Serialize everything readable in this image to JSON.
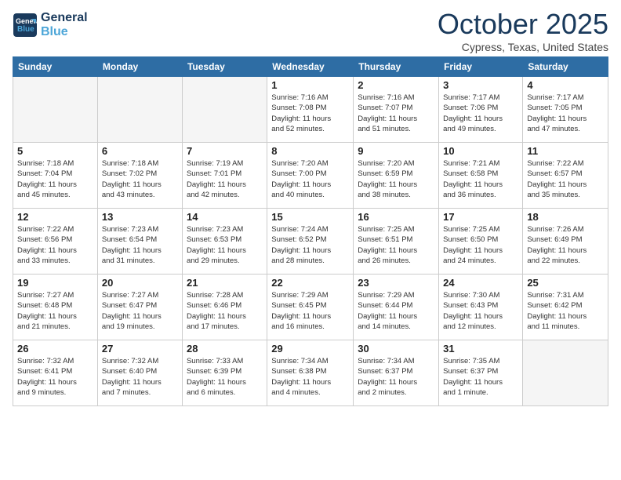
{
  "header": {
    "logo_general": "General",
    "logo_blue": "Blue",
    "month_title": "October 2025",
    "location": "Cypress, Texas, United States"
  },
  "days_of_week": [
    "Sunday",
    "Monday",
    "Tuesday",
    "Wednesday",
    "Thursday",
    "Friday",
    "Saturday"
  ],
  "weeks": [
    [
      {
        "day": "",
        "info": ""
      },
      {
        "day": "",
        "info": ""
      },
      {
        "day": "",
        "info": ""
      },
      {
        "day": "1",
        "info": "Sunrise: 7:16 AM\nSunset: 7:08 PM\nDaylight: 11 hours\nand 52 minutes."
      },
      {
        "day": "2",
        "info": "Sunrise: 7:16 AM\nSunset: 7:07 PM\nDaylight: 11 hours\nand 51 minutes."
      },
      {
        "day": "3",
        "info": "Sunrise: 7:17 AM\nSunset: 7:06 PM\nDaylight: 11 hours\nand 49 minutes."
      },
      {
        "day": "4",
        "info": "Sunrise: 7:17 AM\nSunset: 7:05 PM\nDaylight: 11 hours\nand 47 minutes."
      }
    ],
    [
      {
        "day": "5",
        "info": "Sunrise: 7:18 AM\nSunset: 7:04 PM\nDaylight: 11 hours\nand 45 minutes."
      },
      {
        "day": "6",
        "info": "Sunrise: 7:18 AM\nSunset: 7:02 PM\nDaylight: 11 hours\nand 43 minutes."
      },
      {
        "day": "7",
        "info": "Sunrise: 7:19 AM\nSunset: 7:01 PM\nDaylight: 11 hours\nand 42 minutes."
      },
      {
        "day": "8",
        "info": "Sunrise: 7:20 AM\nSunset: 7:00 PM\nDaylight: 11 hours\nand 40 minutes."
      },
      {
        "day": "9",
        "info": "Sunrise: 7:20 AM\nSunset: 6:59 PM\nDaylight: 11 hours\nand 38 minutes."
      },
      {
        "day": "10",
        "info": "Sunrise: 7:21 AM\nSunset: 6:58 PM\nDaylight: 11 hours\nand 36 minutes."
      },
      {
        "day": "11",
        "info": "Sunrise: 7:22 AM\nSunset: 6:57 PM\nDaylight: 11 hours\nand 35 minutes."
      }
    ],
    [
      {
        "day": "12",
        "info": "Sunrise: 7:22 AM\nSunset: 6:56 PM\nDaylight: 11 hours\nand 33 minutes."
      },
      {
        "day": "13",
        "info": "Sunrise: 7:23 AM\nSunset: 6:54 PM\nDaylight: 11 hours\nand 31 minutes."
      },
      {
        "day": "14",
        "info": "Sunrise: 7:23 AM\nSunset: 6:53 PM\nDaylight: 11 hours\nand 29 minutes."
      },
      {
        "day": "15",
        "info": "Sunrise: 7:24 AM\nSunset: 6:52 PM\nDaylight: 11 hours\nand 28 minutes."
      },
      {
        "day": "16",
        "info": "Sunrise: 7:25 AM\nSunset: 6:51 PM\nDaylight: 11 hours\nand 26 minutes."
      },
      {
        "day": "17",
        "info": "Sunrise: 7:25 AM\nSunset: 6:50 PM\nDaylight: 11 hours\nand 24 minutes."
      },
      {
        "day": "18",
        "info": "Sunrise: 7:26 AM\nSunset: 6:49 PM\nDaylight: 11 hours\nand 22 minutes."
      }
    ],
    [
      {
        "day": "19",
        "info": "Sunrise: 7:27 AM\nSunset: 6:48 PM\nDaylight: 11 hours\nand 21 minutes."
      },
      {
        "day": "20",
        "info": "Sunrise: 7:27 AM\nSunset: 6:47 PM\nDaylight: 11 hours\nand 19 minutes."
      },
      {
        "day": "21",
        "info": "Sunrise: 7:28 AM\nSunset: 6:46 PM\nDaylight: 11 hours\nand 17 minutes."
      },
      {
        "day": "22",
        "info": "Sunrise: 7:29 AM\nSunset: 6:45 PM\nDaylight: 11 hours\nand 16 minutes."
      },
      {
        "day": "23",
        "info": "Sunrise: 7:29 AM\nSunset: 6:44 PM\nDaylight: 11 hours\nand 14 minutes."
      },
      {
        "day": "24",
        "info": "Sunrise: 7:30 AM\nSunset: 6:43 PM\nDaylight: 11 hours\nand 12 minutes."
      },
      {
        "day": "25",
        "info": "Sunrise: 7:31 AM\nSunset: 6:42 PM\nDaylight: 11 hours\nand 11 minutes."
      }
    ],
    [
      {
        "day": "26",
        "info": "Sunrise: 7:32 AM\nSunset: 6:41 PM\nDaylight: 11 hours\nand 9 minutes."
      },
      {
        "day": "27",
        "info": "Sunrise: 7:32 AM\nSunset: 6:40 PM\nDaylight: 11 hours\nand 7 minutes."
      },
      {
        "day": "28",
        "info": "Sunrise: 7:33 AM\nSunset: 6:39 PM\nDaylight: 11 hours\nand 6 minutes."
      },
      {
        "day": "29",
        "info": "Sunrise: 7:34 AM\nSunset: 6:38 PM\nDaylight: 11 hours\nand 4 minutes."
      },
      {
        "day": "30",
        "info": "Sunrise: 7:34 AM\nSunset: 6:37 PM\nDaylight: 11 hours\nand 2 minutes."
      },
      {
        "day": "31",
        "info": "Sunrise: 7:35 AM\nSunset: 6:37 PM\nDaylight: 11 hours\nand 1 minute."
      },
      {
        "day": "",
        "info": ""
      }
    ]
  ]
}
